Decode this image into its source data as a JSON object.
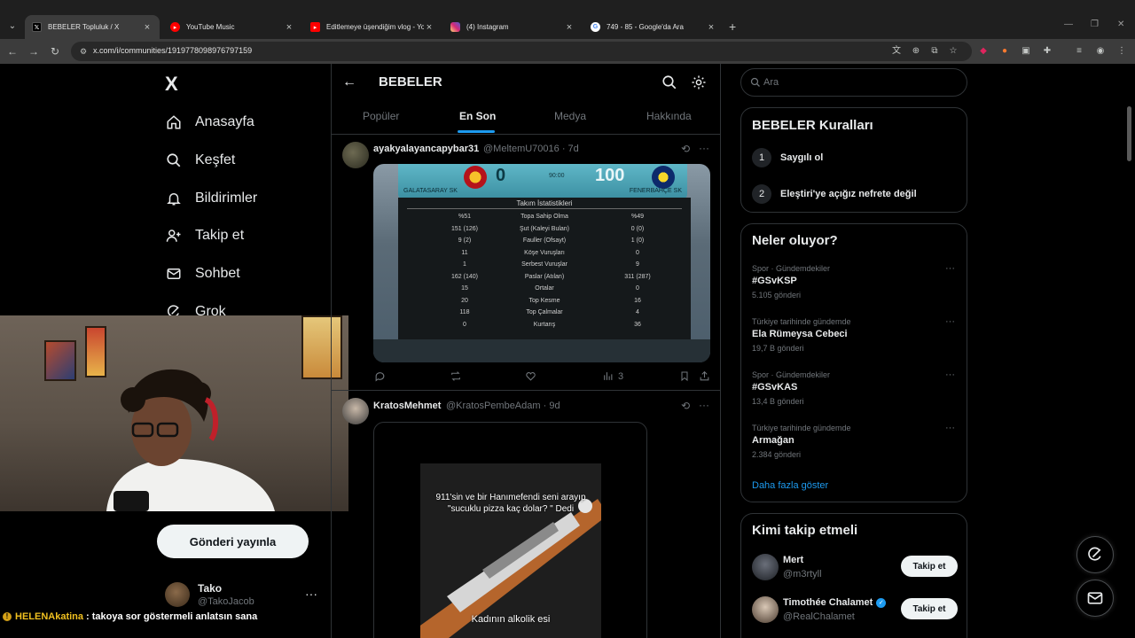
{
  "browser": {
    "tabs": [
      {
        "title": "BEBELER Topluluk / X",
        "favicon": "x-logo",
        "fav_color": "#000000",
        "active": true
      },
      {
        "title": "YouTube Music",
        "favicon": "youtube-music-icon",
        "fav_color": "#ff0000"
      },
      {
        "title": "Editlemeye üşendiğim vlog - Yo",
        "favicon": "youtube-icon",
        "fav_color": "#ff0000"
      },
      {
        "title": "(4) Instagram",
        "favicon": "instagram-icon",
        "fav_color": "#d62976"
      },
      {
        "title": "749 - 85 - Google'da Ara",
        "favicon": "google-icon",
        "fav_color": "#ffffff"
      }
    ],
    "url": "x.com/i/communities/1919778098976797159"
  },
  "nav": {
    "logo": "X",
    "items": [
      {
        "label": "Anasayfa",
        "icon": "home-icon"
      },
      {
        "label": "Keşfet",
        "icon": "search-icon"
      },
      {
        "label": "Bildirimler",
        "icon": "bell-icon"
      },
      {
        "label": "Takip et",
        "icon": "add-user-icon"
      },
      {
        "label": "Sohbet",
        "icon": "mail-icon"
      },
      {
        "label": "Grok",
        "icon": "grok-icon"
      }
    ],
    "post_button": "Gönderi yayınla",
    "profile": {
      "name": "Tako",
      "handle": "@TakoJacob"
    }
  },
  "chat": {
    "user": "HELENAkatina",
    "message": ": takoya sor göstermeli anlatsın sana"
  },
  "community": {
    "title": "BEBELER",
    "tabs": [
      {
        "label": "Popüler",
        "active": false
      },
      {
        "label": "En Son",
        "active": true
      },
      {
        "label": "Medya",
        "active": false
      },
      {
        "label": "Hakkında",
        "active": false
      }
    ]
  },
  "tweets": [
    {
      "name": "ayakyalayancapybar31",
      "meta": "@MeltemU70016 · 7d",
      "image": {
        "home_team": "GALATASARAY SK",
        "away_team": "FENERBAHÇE SK",
        "home_score": "0",
        "away_score": "100",
        "time": "90:00",
        "panel_title": "Takım İstatistikleri",
        "rows": [
          {
            "label": "Topa Sahip Olma",
            "home": "%51",
            "away": "%49"
          },
          {
            "label": "Şut (Kaleyi Bulan)",
            "home": "151 (126)",
            "away": "0 (0)"
          },
          {
            "label": "Fauller (Ofsayt)",
            "home": "9 (2)",
            "away": "1 (0)"
          },
          {
            "label": "Köşe Vuruşları",
            "home": "11",
            "away": "0"
          },
          {
            "label": "Serbest Vuruşlar",
            "home": "1",
            "away": "9"
          },
          {
            "label": "Paslar (Atılan)",
            "home": "162 (140)",
            "away": "311 (287)"
          },
          {
            "label": "Ortalar",
            "home": "15",
            "away": "0"
          },
          {
            "label": "Top Kesme",
            "home": "20",
            "away": "16"
          },
          {
            "label": "Top Çalmalar",
            "home": "118",
            "away": "4"
          },
          {
            "label": "Kurtarış",
            "home": "0",
            "away": "36"
          }
        ]
      },
      "views": "3"
    },
    {
      "name": "KratosMehmet",
      "meta": "@KratosPembeAdam · 9d",
      "video": {
        "top_caption": "911'sin ve bir Hanımefendi seni arayıp \"sucuklu pizza kaç dolar? \" Dedi",
        "bottom_caption": "Kadının alkolik esi"
      }
    }
  ],
  "search": {
    "placeholder": "Ara"
  },
  "rules": {
    "title": "BEBELER Kuralları",
    "items": [
      {
        "num": "1",
        "text": "Saygılı ol"
      },
      {
        "num": "2",
        "text": "Eleştiri'ye açığız nefrete değil"
      }
    ]
  },
  "trends": {
    "title": "Neler oluyor?",
    "items": [
      {
        "context": "Spor · Gündemdekiler",
        "name": "#GSvKSP",
        "count": "5.105 gönderi"
      },
      {
        "context": "Türkiye tarihinde gündemde",
        "name": "Ela Rümeysa Cebeci",
        "count": "19,7 B gönderi"
      },
      {
        "context": "Spor · Gündemdekiler",
        "name": "#GSvKAS",
        "count": "13,4 B gönderi"
      },
      {
        "context": "Türkiye tarihinde gündemde",
        "name": "Armağan",
        "count": "2.384 gönderi"
      }
    ],
    "show_more": "Daha fazla göster"
  },
  "who_to_follow": {
    "title": "Kimi takip etmeli",
    "users": [
      {
        "name": "Mert",
        "handle": "@m3rtyll",
        "verified": false,
        "button": "Takip et"
      },
      {
        "name": "Timothée Chalamet",
        "handle": "@RealChalamet",
        "verified": true,
        "button": "Takip et"
      }
    ]
  }
}
